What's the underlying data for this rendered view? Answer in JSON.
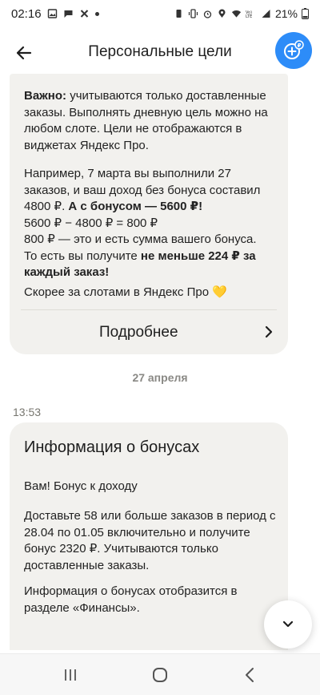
{
  "status_bar": {
    "time": "02:16",
    "battery": "21%",
    "left_icons": [
      "photo-icon",
      "message-icon",
      "tools-icon",
      "dot-icon"
    ],
    "right_icons": [
      "battery-saver-icon",
      "vibrate-icon",
      "alarm-icon",
      "location-icon",
      "wifi-icon",
      "volte-icon",
      "signal-icon",
      "battery-icon"
    ]
  },
  "header": {
    "title": "Персональные цели",
    "back_icon": "arrow-left-icon",
    "add_icon": "goal-plus-icon",
    "add_color": "#2d8cf8"
  },
  "message_1": {
    "important_label": "Важно:",
    "important_text": " учитываются только доставленные заказы. Выполнять дневную цель можно на любом слоте. Цели не отображаются в виджетах Яндекс Про.",
    "example_text": "Например, 7 марта вы выполнили 27 заказов, и ваш доход без бонуса составил 4800 ₽.",
    "with_bonus": " А с бонусом — 5600 ₽!",
    "calc_line": "5600 ₽ − 4800 ₽ = 800 ₽",
    "sum_line": "800 ₽ — это и есть сумма вашего бонуса.",
    "per_order_prefix": "То есть вы получите ",
    "per_order_bold": "не меньше 224 ₽ за каждый заказ!",
    "slots_text": "Скорее за слотами в Яндекс Про",
    "emoji": "💛",
    "more_label": "Подробнее"
  },
  "date_separator": "27 апреля",
  "message_time": "13:53",
  "message_2": {
    "title": "Информация о бонусах",
    "greeting": "Вам! Бонус к доходу",
    "body": "Доставьте 58 или больше заказов в период с 28.04 по 01.05 включительно и получите бонус 2320 ₽. Учитываются только доставленные заказы.",
    "footer": "Информация о бонусах отобразится в разделе «Финансы»."
  },
  "scroll_down_icon": "chevron-down-icon",
  "navbar": {
    "recent_icon": "recent-apps-icon",
    "home_icon": "home-icon",
    "back_icon": "back-icon"
  }
}
